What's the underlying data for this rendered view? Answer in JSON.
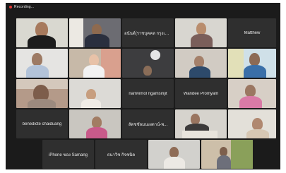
{
  "recording": {
    "label": "Recording..."
  },
  "rows": [
    [
      {
        "type": "video",
        "name": "participant-1"
      },
      {
        "type": "video",
        "name": "participant-2"
      },
      {
        "type": "text",
        "label": "อนันต์(ราชบุคคล กรุงเทพ)"
      },
      {
        "type": "video",
        "name": "participant-3"
      },
      {
        "type": "text",
        "label": "Matthew"
      }
    ],
    [
      {
        "type": "video",
        "name": "participant-4"
      },
      {
        "type": "video",
        "name": "participant-5"
      },
      {
        "type": "video",
        "name": "participant-6"
      },
      {
        "type": "video",
        "name": "participant-7"
      },
      {
        "type": "video",
        "name": "participant-8"
      }
    ],
    [
      {
        "type": "video",
        "name": "participant-9"
      },
      {
        "type": "video",
        "name": "participant-10"
      },
      {
        "type": "text",
        "label": "namvimol ngamsirijit"
      },
      {
        "type": "text",
        "label": "Wandee Promyam"
      },
      {
        "type": "video",
        "name": "participant-11"
      }
    ],
    [
      {
        "type": "text",
        "label": "benedicte chaiduang"
      },
      {
        "type": "video",
        "name": "participant-12"
      },
      {
        "type": "text",
        "label": "ลัดชชัลมนเผดาน์-พ..."
      },
      {
        "type": "video",
        "name": "participant-13"
      },
      {
        "type": "video",
        "name": "participant-14"
      }
    ],
    [
      {
        "type": "text",
        "label": "iPhone ของ Samang"
      },
      {
        "type": "text",
        "label": "ธนาวิช กิจชนิด"
      },
      {
        "type": "video",
        "name": "participant-15"
      },
      {
        "type": "video",
        "name": "participant-16"
      }
    ]
  ]
}
